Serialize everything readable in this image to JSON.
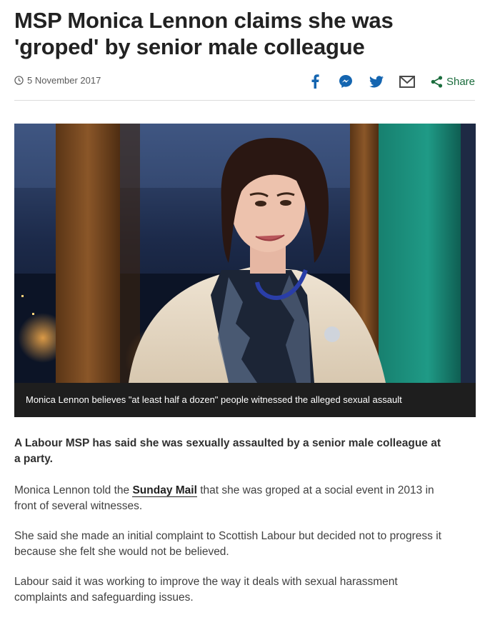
{
  "article": {
    "headline": "MSP Monica Lennon claims she was 'groped' by senior male colleague",
    "date": "5 November 2017",
    "share_label": "Share",
    "image_caption": "Monica Lennon believes \"at least half a dozen\" people witnessed the alleged sexual assault",
    "lead": "A Labour MSP has said she was sexually assaulted by a senior male colleague at a party.",
    "p1_before": "Monica Lennon told the ",
    "p1_link": "Sunday Mail",
    "p1_after": " that she was groped at a social event in 2013 in front of several witnesses.",
    "p2": "She said she made an initial complaint to Scottish Labour but decided not to progress it because she felt she would not be believed.",
    "p3": "Labour said it was working to improve the way it deals with sexual harassment complaints and safeguarding issues."
  },
  "icons": {
    "clock": "clock-icon",
    "facebook": "facebook-icon",
    "messenger": "messenger-icon",
    "twitter": "twitter-icon",
    "email": "email-icon",
    "share": "share-icon"
  },
  "colors": {
    "brand_blue": "#1465b0",
    "share_green": "#1a6c3c",
    "caption_bg": "#1e1e1e"
  }
}
